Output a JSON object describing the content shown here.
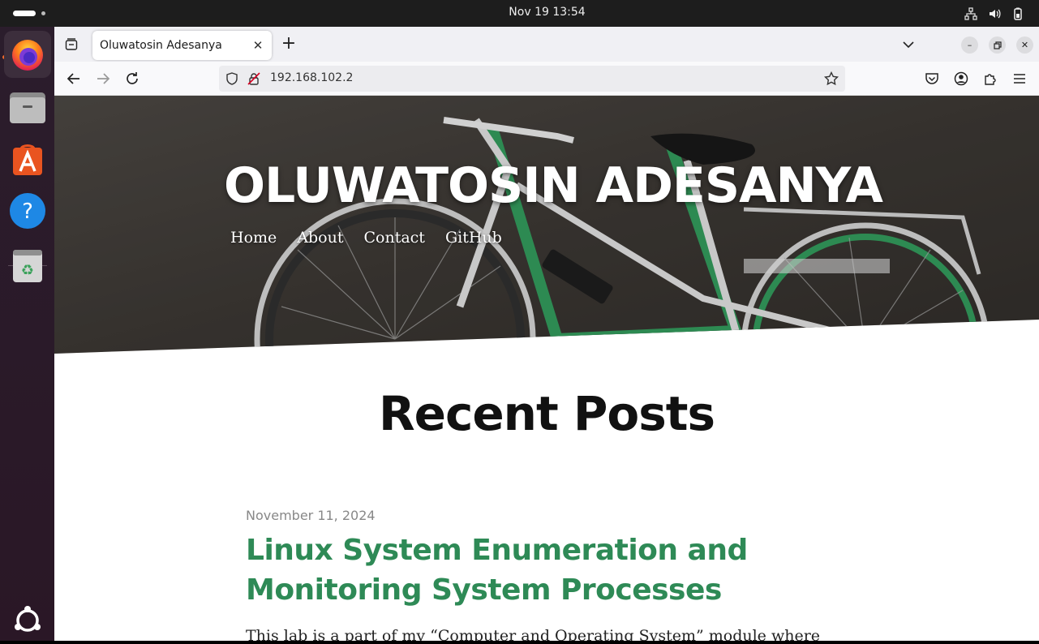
{
  "system": {
    "clock": "Nov 19  13:54"
  },
  "dock": {
    "items": [
      {
        "name": "Firefox"
      },
      {
        "name": "Files"
      },
      {
        "name": "App Center"
      },
      {
        "name": "Help"
      },
      {
        "name": "Trash"
      }
    ]
  },
  "browser": {
    "tab_title": "Oluwatosin Adesanya",
    "url": "192.168.102.2"
  },
  "site": {
    "title": "OLUWATOSIN ADESANYA",
    "nav": [
      "Home",
      "About",
      "Contact",
      "GitHub"
    ],
    "section_heading": "Recent Posts",
    "post": {
      "date": "November 11, 2024",
      "title": "Linux System Enumeration and Monitoring System Processes",
      "excerpt": "This lab is a part of my “Computer and Operating System” module where"
    }
  },
  "colors": {
    "post_title": "#2e8a56",
    "dock_bg": "#2b1d2c",
    "topbar_bg": "#1d1d1d"
  }
}
